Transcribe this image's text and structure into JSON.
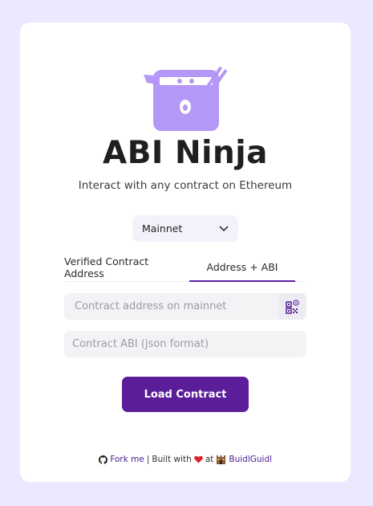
{
  "app": {
    "title": "ABI Ninja",
    "subtitle": "Interact with any contract on Ethereum"
  },
  "network": {
    "selected": "Mainnet"
  },
  "tabs": [
    {
      "label": "Verified Contract Address"
    },
    {
      "label": "Address + ABI"
    }
  ],
  "fields": {
    "address_placeholder": "Contract address on mainnet",
    "abi_placeholder": "Contract ABI (json format)"
  },
  "actions": {
    "load_label": "Load Contract"
  },
  "footer": {
    "fork_label": "Fork me",
    "separator": "|",
    "built_with": "Built with",
    "at": "at",
    "org_label": "BuidlGuidl"
  },
  "colors": {
    "accent": "#5b1d99",
    "logo": "#b497f7",
    "background": "#ece8ff"
  },
  "icons": [
    "ninja-logo",
    "chevron-down-icon",
    "qr-code-icon",
    "github-icon",
    "heart-icon",
    "castle-icon"
  ]
}
